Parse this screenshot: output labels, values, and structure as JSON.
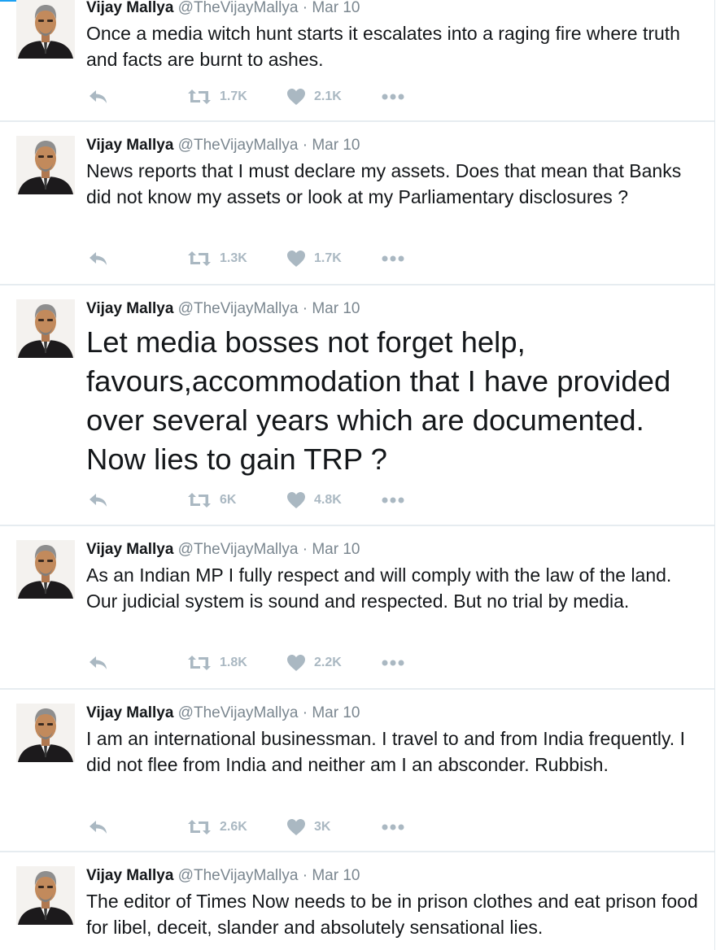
{
  "author": {
    "name": "Vijay Mallya",
    "handle": "@TheVijayMallya",
    "separator": "·"
  },
  "colors": {
    "icon_gray": "#aab8c2",
    "meta_gray": "#7b8790",
    "divider": "#e6ecf0"
  },
  "icons": {
    "reply": "reply-icon",
    "retweet": "retweet-icon",
    "like": "heart-icon",
    "more": "more-dots-icon"
  },
  "tweets": [
    {
      "time": "Mar 10",
      "text": "Once a media witch hunt starts it escalates into a raging fire where truth and facts are burnt to ashes.",
      "retweets": "1.7K",
      "likes": "2.1K"
    },
    {
      "time": "Mar 10",
      "text": "News reports that I must declare my assets. Does that mean that Banks did not know my assets or look at my Parliamentary disclosures ?",
      "retweets": "1.3K",
      "likes": "1.7K"
    },
    {
      "time": "Mar 10",
      "text": "Let media bosses not forget help, favours,accommodation that I have provided over several years which are documented. Now lies to gain TRP ?",
      "retweets": "6K",
      "likes": "4.8K"
    },
    {
      "time": "Mar 10",
      "text": "As an Indian MP I fully respect and will comply with the law of the land. Our judicial system is sound and respected. But no trial by media.",
      "retweets": "1.8K",
      "likes": "2.2K"
    },
    {
      "time": "Mar 10",
      "text": "I am an international businessman. I travel to and from India frequently. I did not flee from India and neither am I an absconder. Rubbish.",
      "retweets": "2.6K",
      "likes": "3K"
    },
    {
      "time": "Mar 10",
      "text": "The editor of Times Now needs to be in prison clothes and eat prison food for libel, deceit, slander and absolutely sensational lies."
    }
  ]
}
